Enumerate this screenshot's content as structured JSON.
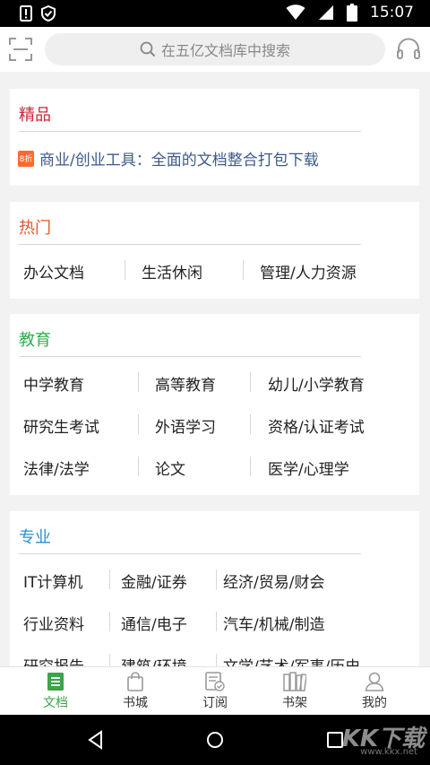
{
  "status_bar": {
    "time": "15:07"
  },
  "search": {
    "placeholder": "在五亿文档库中搜索"
  },
  "sections": {
    "featured": {
      "title": "精品",
      "title_color": "#d0243a",
      "badge": "8折",
      "item": "商业/创业工具：全面的文档整合打包下载"
    },
    "hot": {
      "title": "热门",
      "title_color": "#e0582a",
      "items": [
        "办公文档",
        "生活休闲",
        "管理/人力资源"
      ]
    },
    "education": {
      "title": "教育",
      "title_color": "#2fae4e",
      "items": [
        "中学教育",
        "高等教育",
        "幼儿/小学教育",
        "研究生考试",
        "外语学习",
        "资格/认证考试",
        "法律/法学",
        "论文",
        "医学/心理学"
      ]
    },
    "professional": {
      "title": "专业",
      "title_color": "#2a8fd0",
      "items": [
        "IT计算机",
        "金融/证券",
        "经济/贸易/财会",
        "行业资料",
        "通信/电子",
        "汽车/机械/制造",
        "研究报告",
        "建筑/环境",
        "文学/艺术/军事/历史"
      ]
    }
  },
  "tabs": [
    {
      "label": "文档",
      "icon": "document-icon",
      "active": true
    },
    {
      "label": "书城",
      "icon": "shopping-bag-icon",
      "active": false
    },
    {
      "label": "订阅",
      "icon": "subscription-icon",
      "active": false
    },
    {
      "label": "书架",
      "icon": "bookshelf-icon",
      "active": false
    },
    {
      "label": "我的",
      "icon": "profile-icon",
      "active": false
    }
  ],
  "watermark": {
    "brand": "KK下载",
    "url": "www.kkx.net"
  },
  "colors": {
    "accent": "#3aa54a"
  }
}
